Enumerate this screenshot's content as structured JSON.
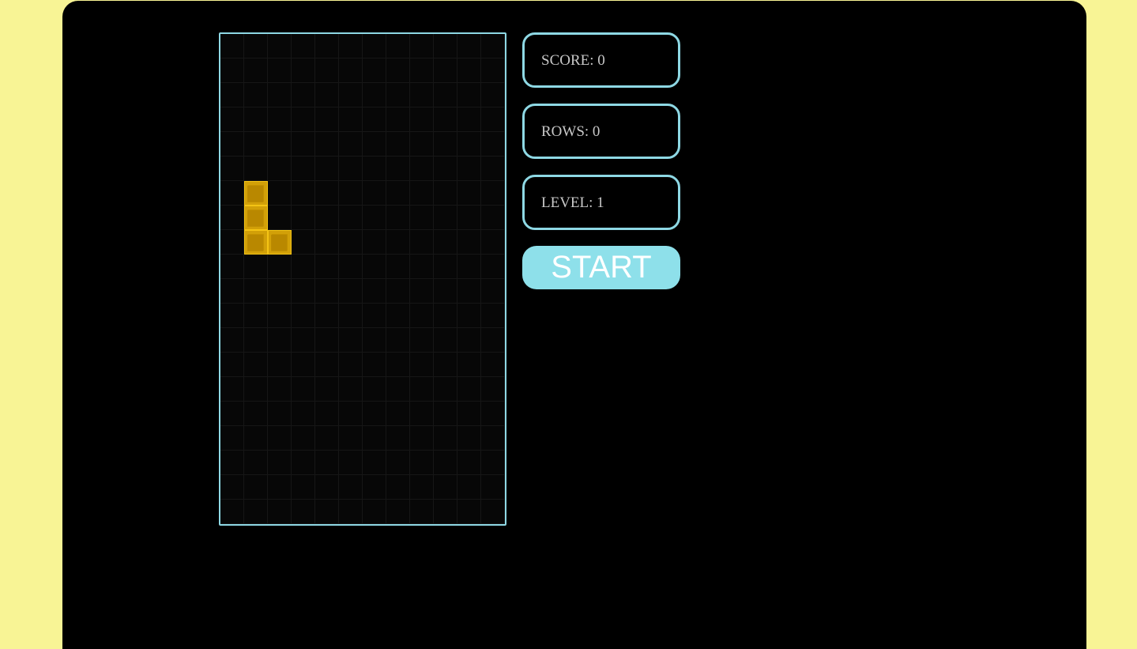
{
  "colors": {
    "page_background": "#f8f495",
    "frame_background": "#000000",
    "accent": "#8ed8e4",
    "piece": "#c79400",
    "text": "#c8c8c8"
  },
  "game": {
    "grid": {
      "columns": 12,
      "rows": 20
    },
    "active_piece": {
      "shape": "L",
      "cells": [
        {
          "row": 6,
          "col": 1
        },
        {
          "row": 7,
          "col": 1
        },
        {
          "row": 8,
          "col": 1
        },
        {
          "row": 8,
          "col": 2
        }
      ]
    }
  },
  "stats": {
    "score_text": "SCORE: 0",
    "rows_text": "ROWS: 0",
    "level_text": "LEVEL: 1"
  },
  "controls": {
    "start_label": "START"
  }
}
